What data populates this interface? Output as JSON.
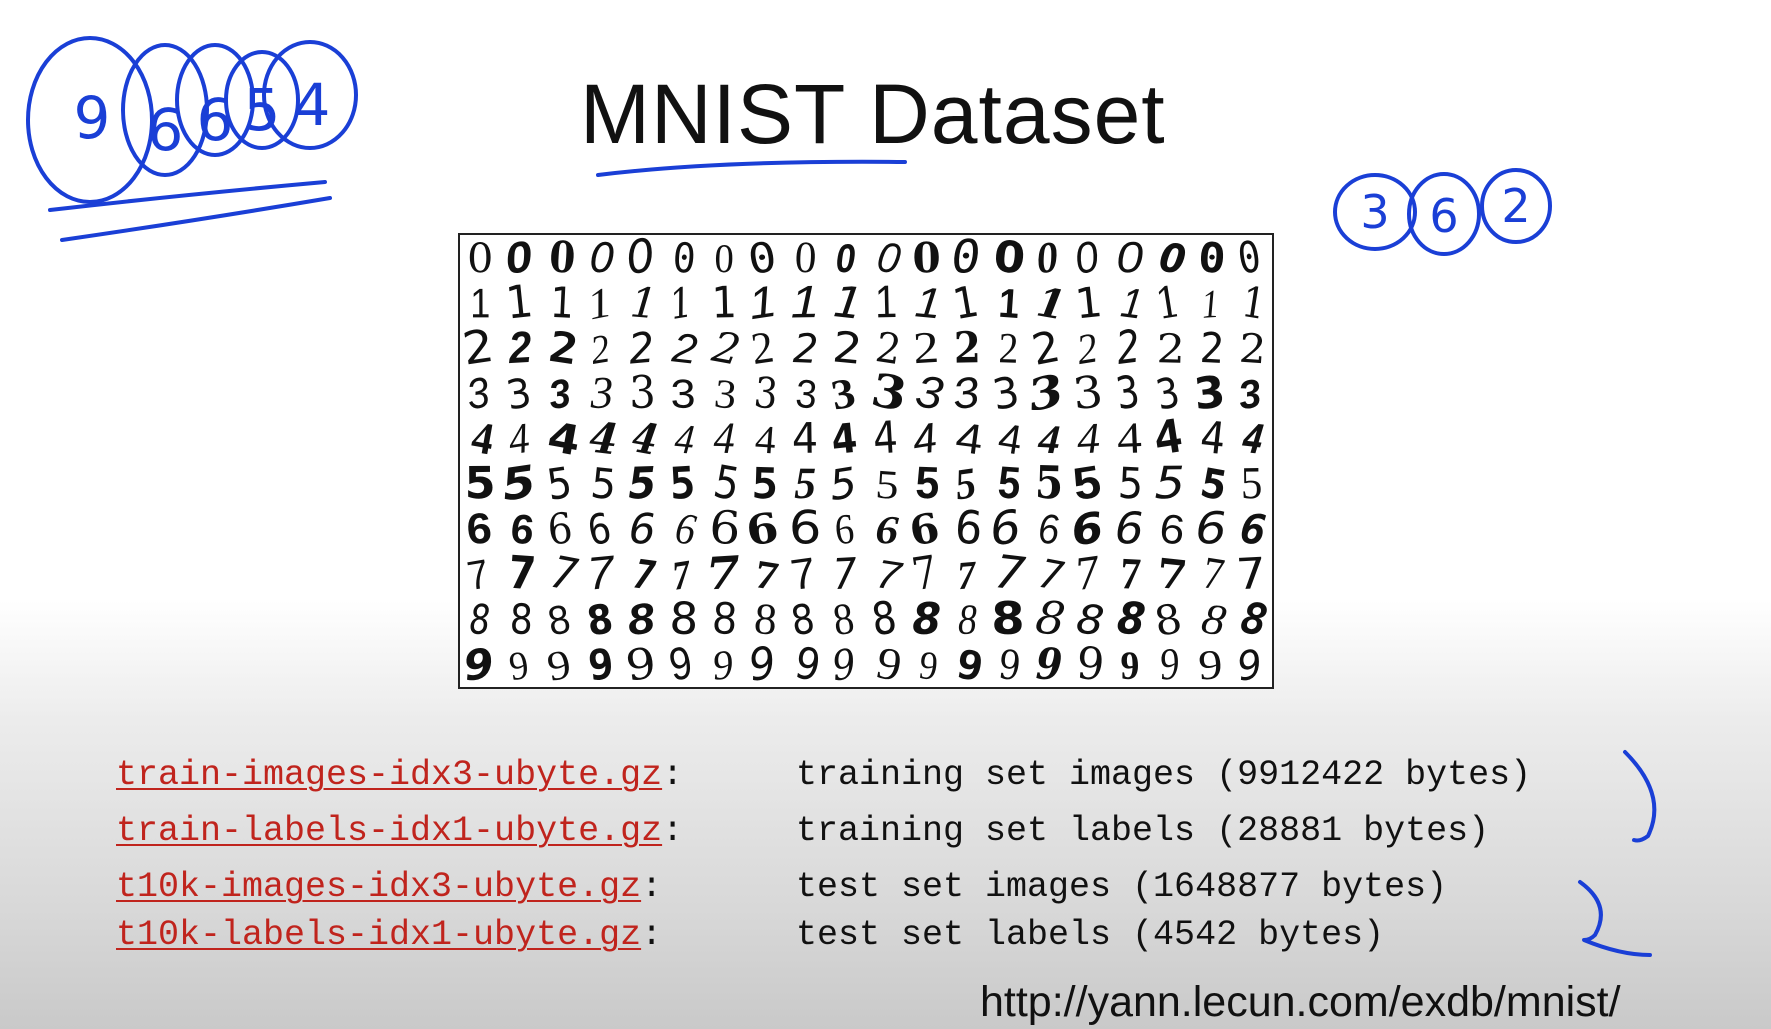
{
  "slide": {
    "title": "MNIST Dataset",
    "url": "http://yann.lecun.com/exdb/mnist/"
  },
  "digit_grid": {
    "rows": [
      "0",
      "1",
      "2",
      "3",
      "4",
      "5",
      "6",
      "7",
      "8",
      "9"
    ],
    "columns": 20
  },
  "files": [
    {
      "name": "train-images-idx3-ubyte.gz",
      "description": "training set images (9912422 bytes)"
    },
    {
      "name": "train-labels-idx1-ubyte.gz",
      "description": "training set labels (28881 bytes)"
    },
    {
      "name": "t10k-images-idx3-ubyte.gz",
      "description": "test set images (1648877 bytes)"
    },
    {
      "name": "t10k-labels-idx1-ubyte.gz",
      "description": "test set labels (4542 bytes)"
    }
  ],
  "annotations": {
    "left_circled_digits": [
      "9",
      "6",
      "6",
      "5",
      "4"
    ],
    "right_circled_digits": [
      "3",
      "6",
      "2"
    ],
    "ink_color": "#1a3fd6"
  }
}
